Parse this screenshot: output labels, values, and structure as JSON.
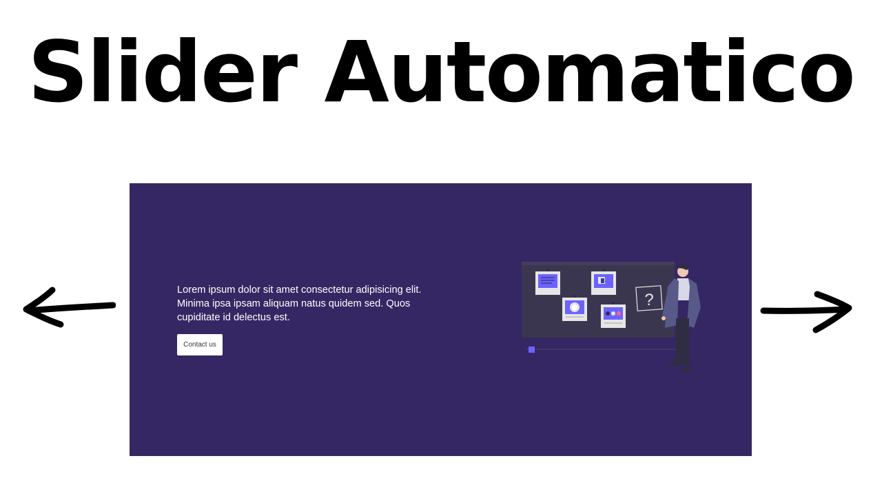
{
  "heading": {
    "title": "Slider Automatico"
  },
  "slider": {
    "background_color": "#352763",
    "slide": {
      "text": "Lorem ipsum dolor sit amet consectetur adipisicing elit. Minima ipsa ipsam aliquam natus quidem sed. Quos cupiditate id delectus est.",
      "button_label": "Contact us",
      "illustration": {
        "icon": "person-presenting-board-icon",
        "board_symbol": "?",
        "accent_color": "#6c63ff"
      }
    }
  },
  "navigation": {
    "prev_icon": "arrow-left-icon",
    "next_icon": "arrow-right-icon"
  }
}
